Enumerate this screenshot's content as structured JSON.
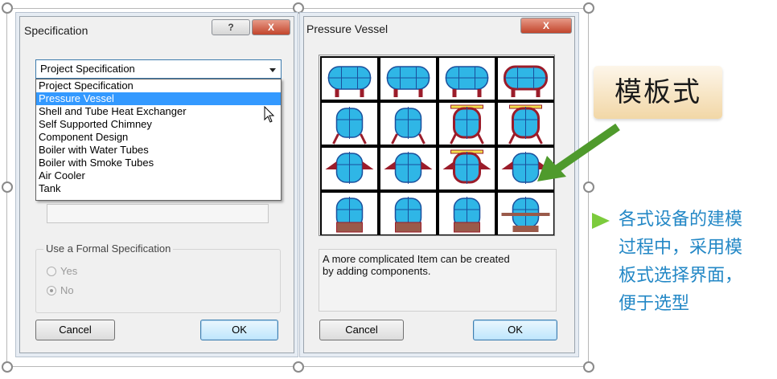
{
  "spec_dialog": {
    "title": "Specification",
    "help_label": "?",
    "close_label": "X",
    "dropdown_value": "Project Specification",
    "list_items": [
      "Project Specification",
      "Pressure Vessel",
      "Shell and Tube Heat Exchanger",
      "Self Supported Chimney",
      "Component Design",
      "Boiler with Water Tubes",
      "Boiler with Smoke Tubes",
      "Air Cooler",
      "Tank"
    ],
    "selected_item": "Pressure Vessel",
    "group_label": "Use a Formal Specification",
    "radio_yes": "Yes",
    "radio_no": "No",
    "radio_selected": "No",
    "cancel_label": "Cancel",
    "ok_label": "OK"
  },
  "vessel_dialog": {
    "title": "Pressure Vessel",
    "close_label": "X",
    "description_line1": "A more complicated Item can be created",
    "description_line2": "by adding components.",
    "cancel_label": "Cancel",
    "ok_label": "OK",
    "template_icons": [
      "horizontal-vessel-icon",
      "horizontal-vessel-icon",
      "horizontal-vessel-icon",
      "horizontal-vessel-highlighted-icon",
      "vertical-vessel-legs-icon",
      "vertical-vessel-legs-icon",
      "jacketed-vessel-legs-icon",
      "jacketed-vessel-legs-icon",
      "vertical-vessel-lugs-icon",
      "vertical-vessel-lugs-icon",
      "jacketed-vessel-lugs-icon",
      "vertical-vessel-lugs-icon",
      "vertical-vessel-skirt-icon",
      "vertical-vessel-skirt-icon",
      "vertical-vessel-skirt-icon",
      "vertical-vessel-ring-icon"
    ]
  },
  "annotations": {
    "callout_text": "模板式",
    "note_lines": [
      "各式设备的建模",
      "过程中，采用模",
      "板式选择界面，",
      "便于选型"
    ]
  },
  "colors": {
    "vessel_fill": "#2fb6e6",
    "vessel_outline": "#1a4f9c",
    "support_red": "#9b1c2a",
    "highlight_yellow": "#f3e04a",
    "arrow_green": "#4f9a2c",
    "note_blue": "#2488c6",
    "selection_blue": "#3399ff"
  }
}
